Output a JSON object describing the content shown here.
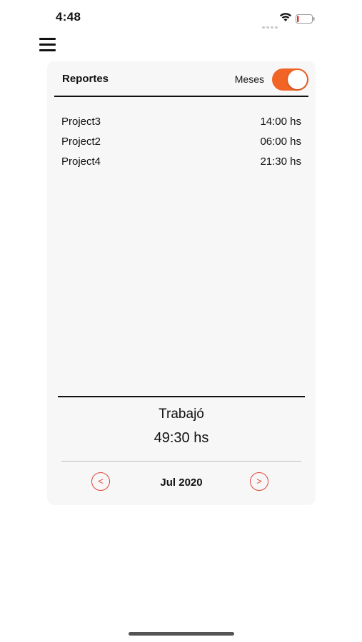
{
  "status_bar": {
    "time": "4:48"
  },
  "header": {
    "title": "Reportes",
    "toggle_label": "Meses",
    "toggle_on": true,
    "accent_color": "#f26425"
  },
  "projects": [
    {
      "name": "Project3",
      "hours": "14:00 hs"
    },
    {
      "name": "Project2",
      "hours": "06:00 hs"
    },
    {
      "name": "Project4",
      "hours": "21:30 hs"
    }
  ],
  "summary": {
    "label": "Trabajó",
    "total": "49:30 hs"
  },
  "navigation": {
    "prev_label": "<",
    "next_label": ">",
    "period": "Jul 2020",
    "button_color": "#e0453a"
  },
  "icons": {
    "menu": "hamburger-icon",
    "wifi": "wifi-icon",
    "battery": "battery-icon",
    "signal": "signal-icon"
  }
}
